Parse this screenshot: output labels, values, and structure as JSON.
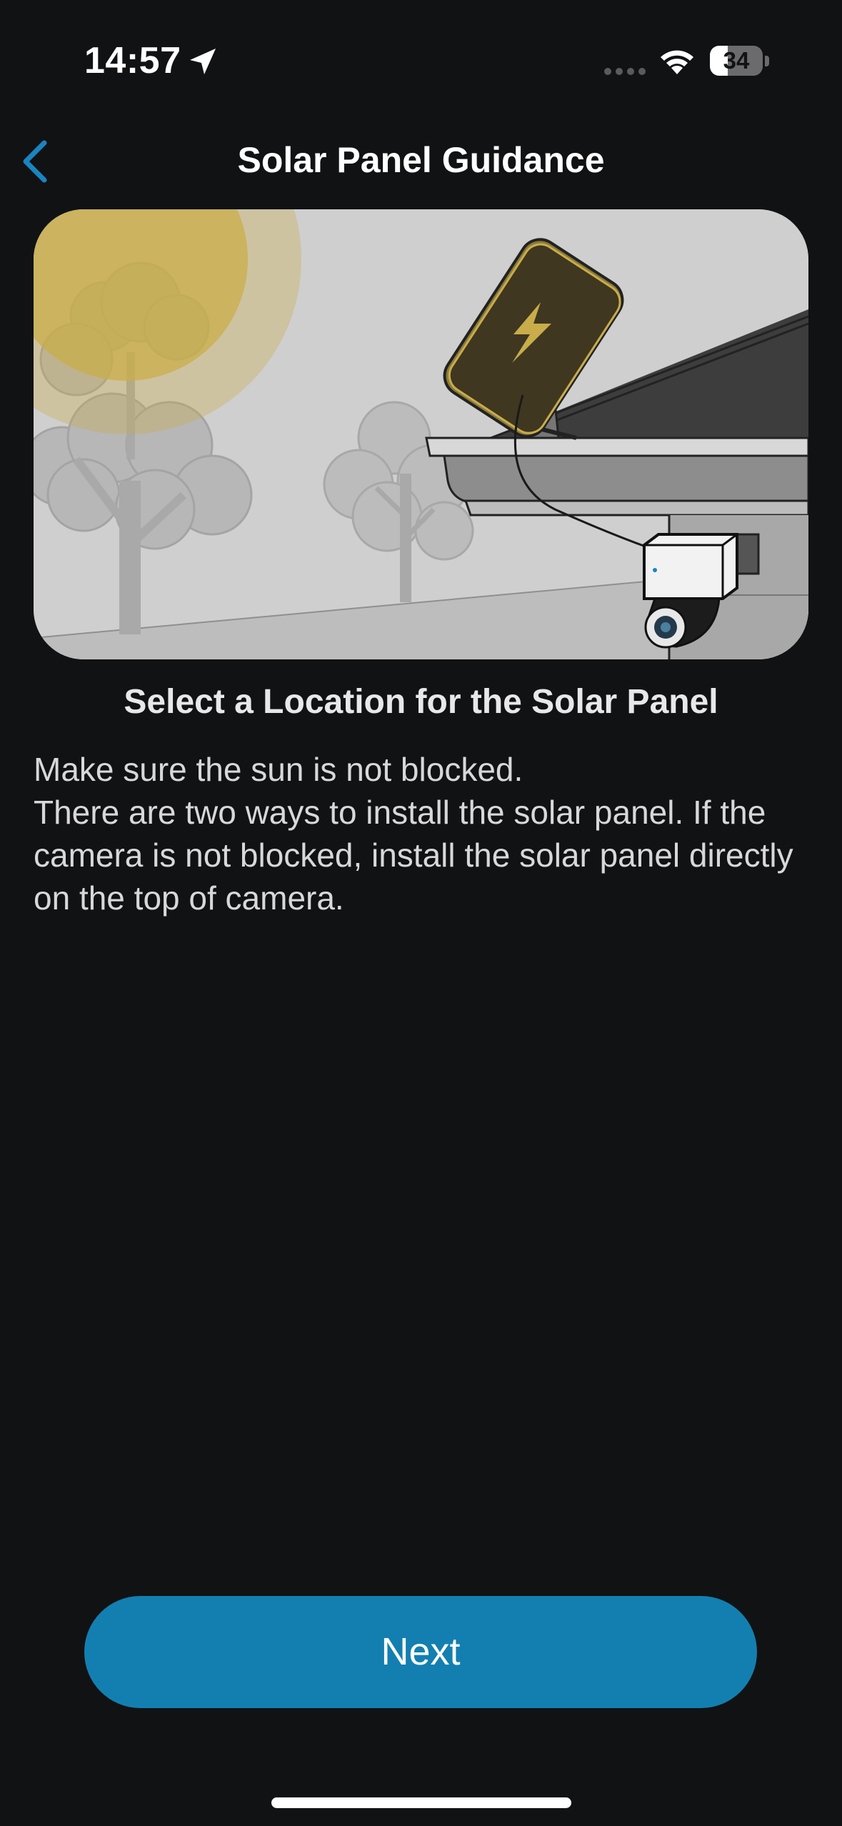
{
  "status_bar": {
    "time": "14:57",
    "battery_level": "34",
    "battery_fraction": 0.34
  },
  "nav": {
    "title": "Solar Panel Guidance",
    "back_icon": "chevron-left-icon"
  },
  "content": {
    "heading": "Select a Location for the Solar Panel",
    "lines": [
      "Make sure the sun is not blocked.",
      "There are two ways to install the solar panel. If the camera is not blocked, install the solar panel directly on the top of camera."
    ]
  },
  "actions": {
    "next_label": "Next"
  },
  "colors": {
    "background": "#111214",
    "accent": "#137fb0",
    "back_chevron": "#1a84c0",
    "sun": "#c9ad4a",
    "panel": "#3f3720"
  }
}
